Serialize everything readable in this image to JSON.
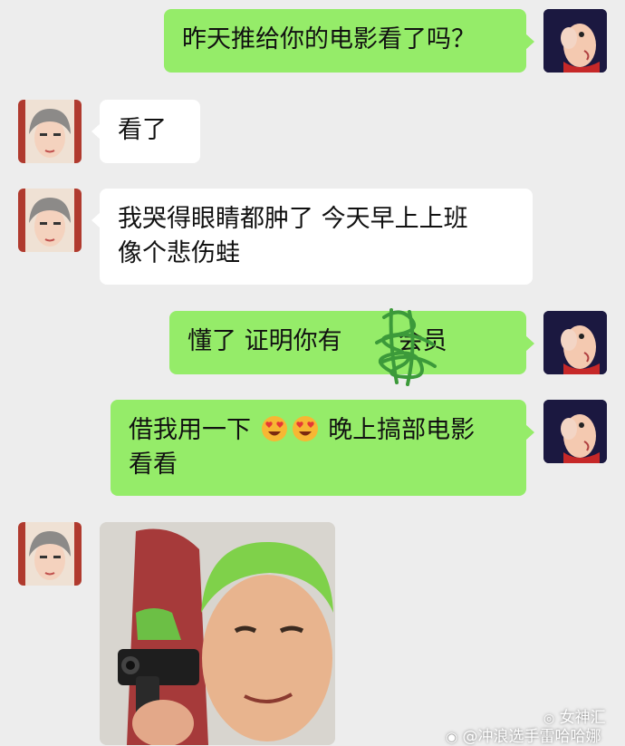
{
  "chat": {
    "messages": [
      {
        "sender": "self",
        "lines": [
          "昨天推给你的电影看了吗？"
        ]
      },
      {
        "sender": "friend",
        "lines": [
          "看了"
        ]
      },
      {
        "sender": "friend",
        "lines": [
          "我哭得眼睛都肿了 今天早上上班",
          "像个悲伤蛙"
        ]
      },
      {
        "sender": "self",
        "lines": [
          "懂了 证明你有",
          "会员"
        ],
        "redacted": true
      },
      {
        "sender": "self",
        "line1_part1": "借我用一下",
        "line1_emoji": "heart-eyes-face-icon",
        "line1_part2": "晚上搞部电影",
        "line2": "看看"
      },
      {
        "sender": "friend",
        "type": "image"
      }
    ]
  },
  "watermark": {
    "brand": "女神汇",
    "handle": "@冲浪选手雷哈哈娜"
  },
  "colors": {
    "background": "#ededed",
    "self_bubble": "#95ec69",
    "friend_bubble": "#ffffff",
    "scribble": "#3c9a3a"
  }
}
